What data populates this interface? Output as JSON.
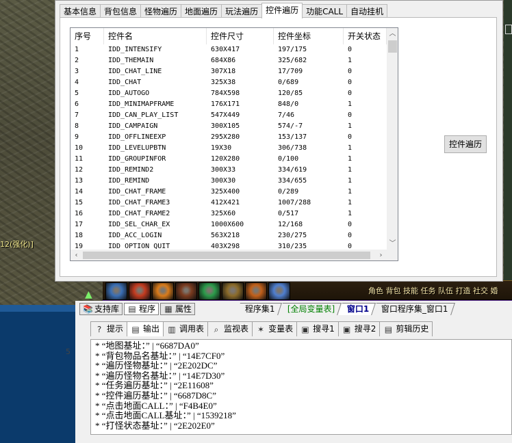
{
  "game": {
    "tag_text": "12(强化)]",
    "hotbar_labels": "角色 背包 技能 任务 队伍 打造 社交 婚",
    "skill_colors": [
      "#3b6fb5",
      "#c43b1f",
      "#d97b1a",
      "#7a3b1f",
      "#2b9b4a",
      "#8b6b2a",
      "#c2601a",
      "#4f7fcf"
    ]
  },
  "dialog": {
    "tabs": [
      {
        "label": "基本信息",
        "active": false
      },
      {
        "label": "背包信息",
        "active": false
      },
      {
        "label": "怪物遍历",
        "active": false
      },
      {
        "label": "地面遍历",
        "active": false
      },
      {
        "label": "玩法遍历",
        "active": false
      },
      {
        "label": "控件遍历",
        "active": true
      },
      {
        "label": "功能CALL",
        "active": false
      },
      {
        "label": "自动挂机",
        "active": false
      }
    ],
    "columns": [
      "序号",
      "控件名",
      "控件尺寸",
      "控件坐标",
      "开关状态"
    ],
    "rows": [
      [
        "1",
        "IDD_INTENSIFY",
        "630X417",
        "197/175",
        "0"
      ],
      [
        "2",
        "IDD_THEMAIN",
        "684X86",
        "325/682",
        "1"
      ],
      [
        "3",
        "IDD_CHAT_LINE",
        "307X18",
        "17/709",
        "0"
      ],
      [
        "4",
        "IDD_CHAT",
        "325X38",
        "0/689",
        "0"
      ],
      [
        "5",
        "IDD_AUTOGO",
        "784X598",
        "120/85",
        "0"
      ],
      [
        "6",
        "IDD_MINIMAPFRAME",
        "176X171",
        "848/0",
        "1"
      ],
      [
        "7",
        "IDD_CAN_PLAY_LIST",
        "547X449",
        "7/46",
        "0"
      ],
      [
        "8",
        "IDD_CAMPAIGN",
        "300X105",
        "574/-7",
        "1"
      ],
      [
        "9",
        "IDD_OFFLINEEXP",
        "295X280",
        "153/137",
        "0"
      ],
      [
        "10",
        "IDD_LEVELUPBTN",
        "19X30",
        "306/738",
        "1"
      ],
      [
        "11",
        "IDD_GROUPINFOR",
        "120X280",
        "0/100",
        "1"
      ],
      [
        "12",
        "IDD_REMIND2",
        "300X33",
        "334/619",
        "1"
      ],
      [
        "13",
        "IDD_REMIND",
        "300X30",
        "334/655",
        "1"
      ],
      [
        "14",
        "IDD_CHAT_FRAME",
        "325X400",
        "0/289",
        "1"
      ],
      [
        "15",
        "IDD_CHAT_FRAME3",
        "412X421",
        "1007/288",
        "1"
      ],
      [
        "16",
        "IDD_CHAT_FRAME2",
        "325X60",
        "0/517",
        "1"
      ],
      [
        "17",
        "IDD_SEL_CHAR_EX",
        "1000X600",
        "12/168",
        "0"
      ],
      [
        "18",
        "IDD_ACC_LOGIN",
        "563X218",
        "230/275",
        "0"
      ],
      [
        "19",
        "IDD_OPTION_QUIT",
        "403X298",
        "310/235",
        "0"
      ]
    ],
    "traverse_button": "控件遍历"
  },
  "ide": {
    "top_tabs": [
      {
        "label": "支持库",
        "icon": "book-icon",
        "selected": false
      },
      {
        "label": "程序",
        "icon": "program-icon",
        "selected": true
      },
      {
        "label": "属性",
        "icon": "property-icon",
        "selected": false
      }
    ],
    "doc_tabs": [
      {
        "label": "程序集1",
        "style": "normal"
      },
      {
        "label": "[全局变量表]",
        "style": "green"
      },
      {
        "label": "窗口1",
        "style": "active"
      },
      {
        "label": "窗口程序集_窗口1",
        "style": "normal"
      }
    ],
    "line_number": "5",
    "output_tabs": [
      {
        "label": "提示",
        "icon": "hint-icon",
        "selected": false
      },
      {
        "label": "输出",
        "icon": "output-icon",
        "selected": true
      },
      {
        "label": "调用表",
        "icon": "call-table-icon",
        "selected": false
      },
      {
        "label": "监视表",
        "icon": "watch-icon",
        "selected": false
      },
      {
        "label": "变量表",
        "icon": "variable-icon",
        "selected": false
      },
      {
        "label": "搜寻1",
        "icon": "search-icon",
        "selected": false
      },
      {
        "label": "搜寻2",
        "icon": "search-icon",
        "selected": false
      },
      {
        "label": "剪辑历史",
        "icon": "clip-history-icon",
        "selected": false
      }
    ],
    "output_lines": [
      "* “地图基址：” | “6687DA0”",
      "* “背包物品名基址：” | “14E7CF0”",
      "* “遍历怪物基址：” | “2E202DC”",
      "* “遍历怪物名基址：” | “14E7D30”",
      "* “任务遍历基址：” | “2E11608”",
      "* “控件遍历基址：” | “6687D8C”",
      "* “点击地面CALL：” | “F4B4E0”",
      "* “点击地面CALL基址：” | “1539218”",
      "* “打怪状态基址：” | “2E202E0”"
    ]
  }
}
